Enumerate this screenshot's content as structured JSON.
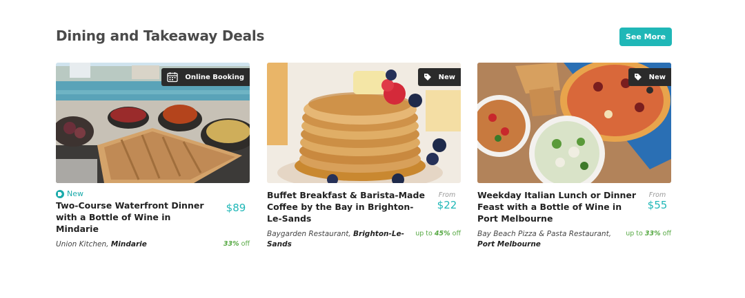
{
  "section": {
    "title": "Dining and Takeaway Deals",
    "see_more_label": "See More"
  },
  "colors": {
    "accent": "#1fb7b7",
    "discount": "#57a944",
    "badge_bg": "#2b2b2b"
  },
  "deals": [
    {
      "badge_label": "Online Booking",
      "badge_icon": "calendar-icon",
      "new_label": "New",
      "title": "Two-Course Waterfront Dinner with a Bottle of Wine in Mindarie",
      "price_from": "",
      "price": "$89",
      "vendor_name": "Union Kitchen,",
      "vendor_location": "Mindarie",
      "discount_prefix": "",
      "discount_pct": "33%",
      "discount_suffix": "off"
    },
    {
      "badge_label": "New",
      "badge_icon": "tag-icon",
      "title": "Buffet Breakfast & Barista-Made Coffee by the Bay in Brighton-Le-Sands",
      "price_from": "From",
      "price": "$22",
      "vendor_name": "Baygarden Restaurant,",
      "vendor_location": "Brighton-Le-Sands",
      "discount_prefix": "up to",
      "discount_pct": "45%",
      "discount_suffix": "off"
    },
    {
      "badge_label": "New",
      "badge_icon": "tag-icon",
      "title": "Weekday Italian Lunch or Dinner Feast with a Bottle of Wine in Port Melbourne",
      "price_from": "From",
      "price": "$55",
      "vendor_name": "Bay Beach Pizza & Pasta Restaurant,",
      "vendor_location": "Port Melbourne",
      "discount_prefix": "up to",
      "discount_pct": "33%",
      "discount_suffix": "off"
    }
  ]
}
